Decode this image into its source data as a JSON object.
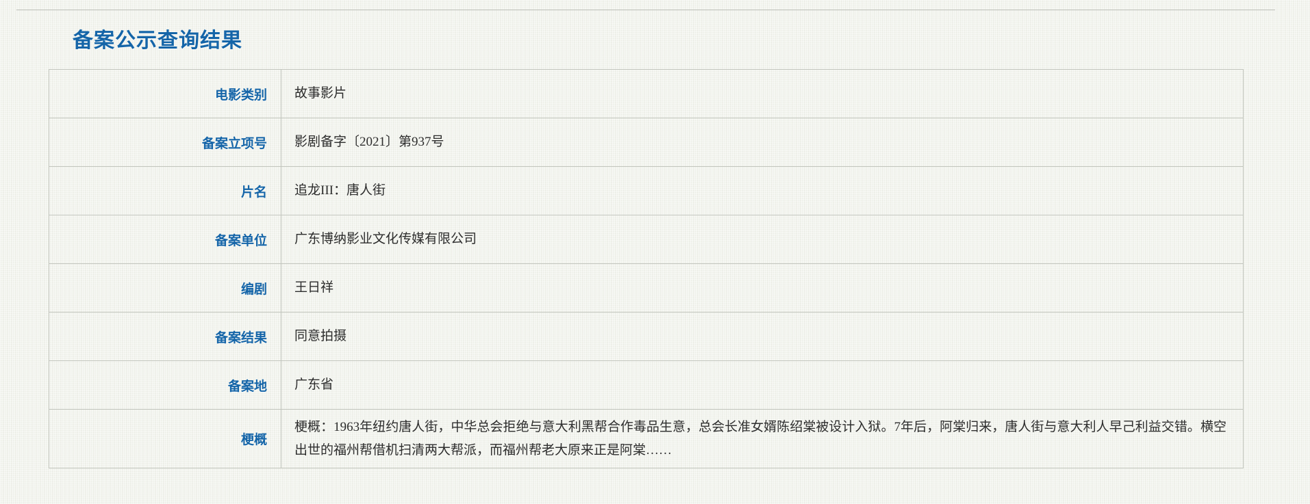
{
  "page": {
    "title": "备案公示查询结果"
  },
  "table": {
    "rows": [
      {
        "label": "电影类别",
        "value": "故事影片"
      },
      {
        "label": "备案立项号",
        "value": "影剧备字〔2021〕第937号"
      },
      {
        "label": "片名",
        "value": "追龙III：唐人街"
      },
      {
        "label": "备案单位",
        "value": "广东博纳影业文化传媒有限公司"
      },
      {
        "label": "编剧",
        "value": "王日祥"
      },
      {
        "label": "备案结果",
        "value": "同意拍摄"
      },
      {
        "label": "备案地",
        "value": "广东省"
      },
      {
        "label": "梗概",
        "value": "梗概：1963年纽约唐人街，中华总会拒绝与意大利黑帮合作毒品生意，总会长准女婿陈绍棠被设计入狱。7年后，阿棠归来，唐人街与意大利人早己利益交错。横空出世的福州帮借机扫清两大帮派，而福州帮老大原来正是阿棠……"
      }
    ]
  },
  "colors": {
    "accent": "#1565a8",
    "text": "#2d2d2d",
    "border": "#c2c5bd",
    "background": "#eff1e9",
    "rule": "#b9bcb4"
  }
}
